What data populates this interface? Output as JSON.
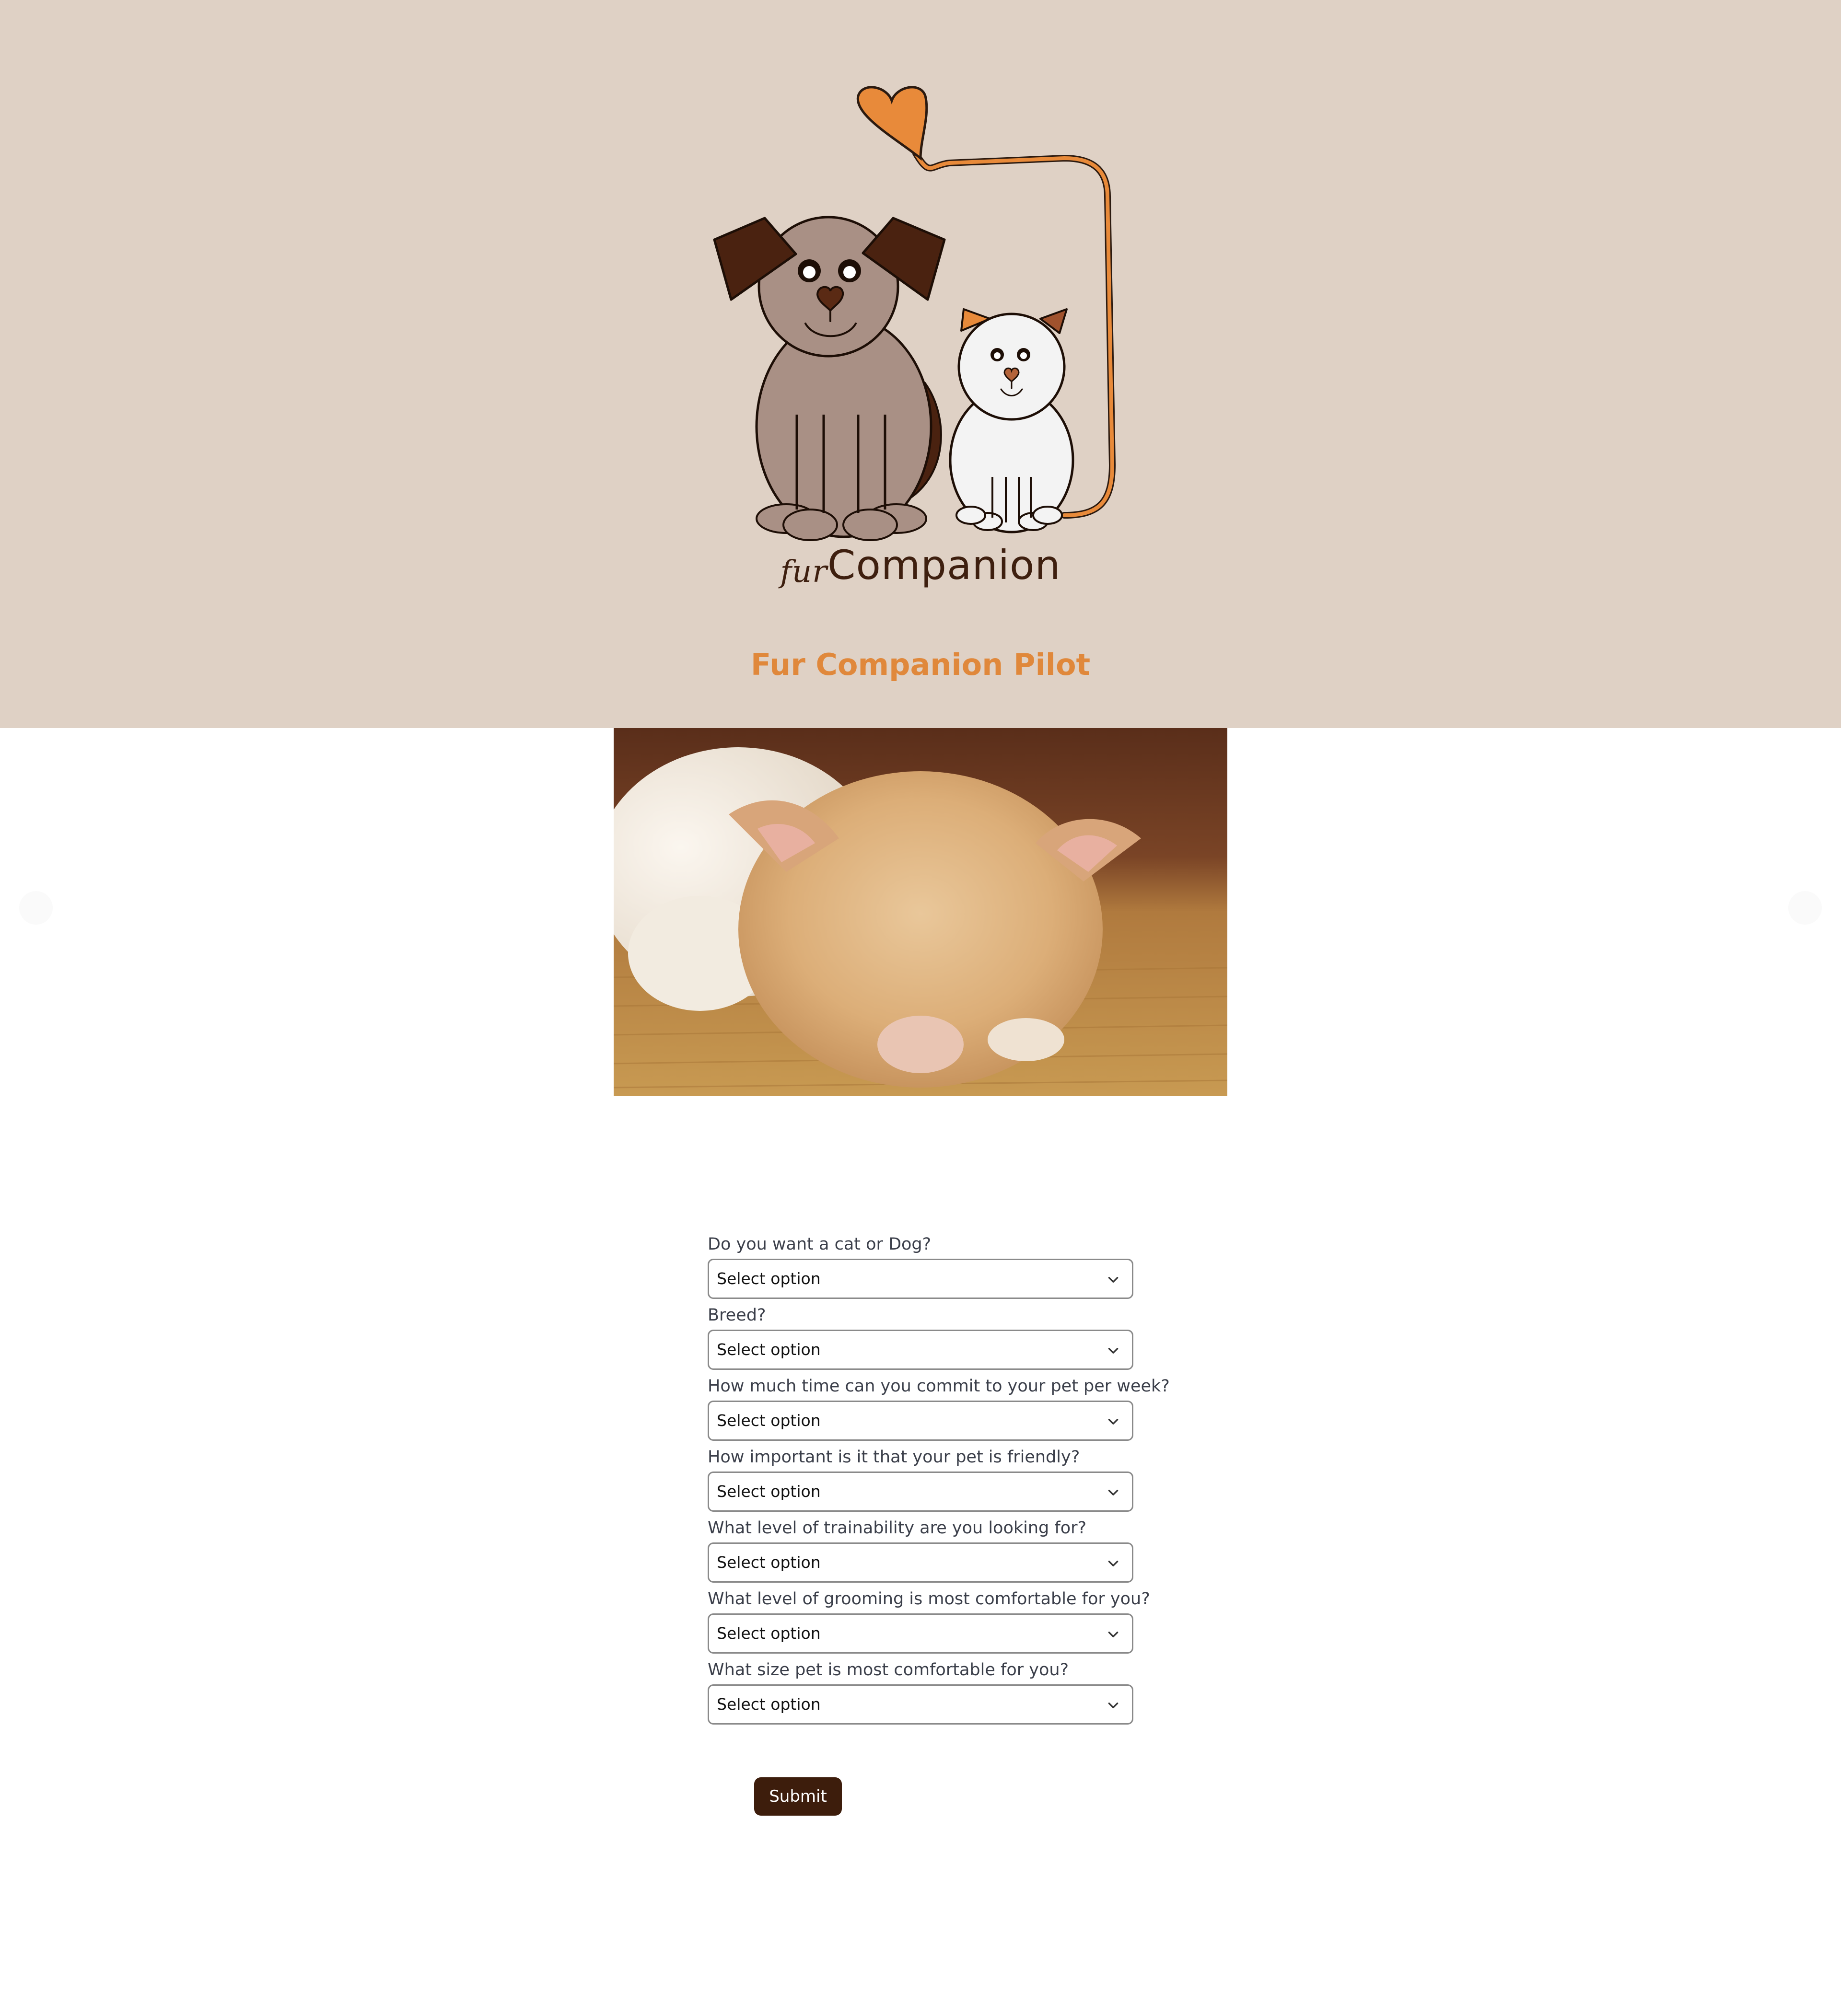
{
  "header": {
    "logo_text_prefix": "fur",
    "logo_text_main": "Companion",
    "site_title": "Fur Companion Pilot",
    "background_color": "#dfd1c5",
    "title_color": "#e0883b"
  },
  "carousel": {
    "image_alt": "sleeping-kitten-photo"
  },
  "form": {
    "fields": [
      {
        "label": "Do you want a cat or Dog?",
        "value": "Select option"
      },
      {
        "label": "Breed?",
        "value": "Select option"
      },
      {
        "label": "How much time can you commit to your pet per week?",
        "value": "Select option"
      },
      {
        "label": "How important is it that your pet is friendly?",
        "value": "Select option"
      },
      {
        "label": "What level of trainability are you looking for?",
        "value": "Select option"
      },
      {
        "label": "What level of grooming is most comfortable for you?",
        "value": "Select option"
      },
      {
        "label": "What size pet is most comfortable for you?",
        "value": "Select option"
      }
    ],
    "submit_label": "Submit",
    "submit_color": "#3d1d0c"
  }
}
